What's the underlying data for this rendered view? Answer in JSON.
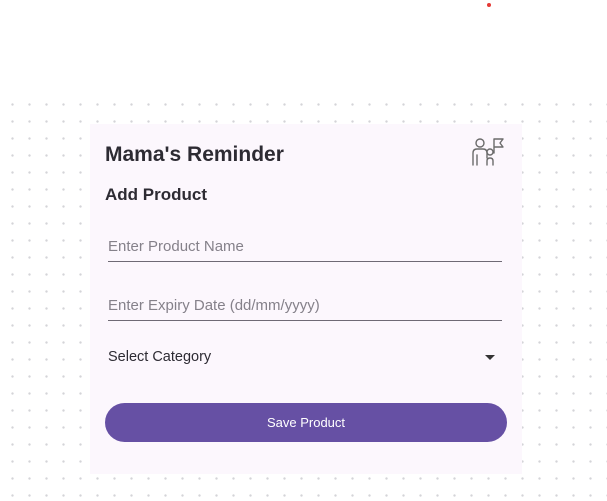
{
  "app": {
    "title": "Mama's Reminder",
    "section_title": "Add Product",
    "header_icon": "family-icon"
  },
  "form": {
    "name_placeholder": "Enter Product Name",
    "expiry_placeholder": "Enter Expiry Date (dd/mm/yyyy)",
    "category_selected": "Select Category",
    "save_label": "Save Product"
  },
  "colors": {
    "accent": "#6650a4",
    "card_background": "#fcf7fd",
    "text_primary": "#2d2b33",
    "placeholder": "#85818a",
    "marker": "#e53935"
  }
}
